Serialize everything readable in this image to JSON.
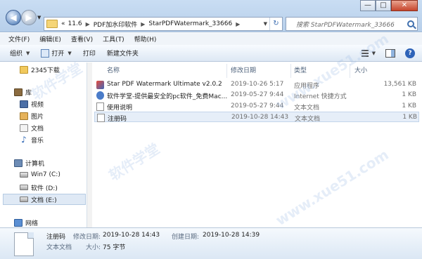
{
  "window": {
    "minimize": "—",
    "maximize": "□",
    "close": "✕"
  },
  "address": {
    "segments": [
      "«",
      "11.6",
      "PDF加水印软件",
      "StarPDFWatermark_33666"
    ],
    "search_placeholder": "搜索 StarPDFWatermark_33666"
  },
  "menubar": [
    "文件(F)",
    "编辑(E)",
    "查看(V)",
    "工具(T)",
    "帮助(H)"
  ],
  "toolbar": {
    "organize": "组织",
    "open": "打开",
    "print": "打印",
    "new_folder": "新建文件夹",
    "help": "?"
  },
  "navpane": {
    "items": [
      {
        "label": "2345下载",
        "icon": "folder-icon"
      },
      {
        "label": "库",
        "icon": "library-icon"
      },
      {
        "label": "视频",
        "icon": "video-icon"
      },
      {
        "label": "图片",
        "icon": "picture-icon"
      },
      {
        "label": "文档",
        "icon": "document-icon"
      },
      {
        "label": "音乐",
        "icon": "music-icon"
      },
      {
        "label": "计算机",
        "icon": "computer-icon"
      },
      {
        "label": "Win7 (C:)",
        "icon": "drive-icon"
      },
      {
        "label": "软件 (D:)",
        "icon": "drive-icon"
      },
      {
        "label": "文档 (E:)",
        "icon": "drive-icon",
        "selected": true
      },
      {
        "label": "网络",
        "icon": "network-icon"
      }
    ]
  },
  "filelist": {
    "columns": [
      "名称",
      "修改日期",
      "类型",
      "大小"
    ],
    "rows": [
      {
        "name": "Star PDF Watermark Ultimate v2.0.2",
        "date": "2019-10-26 5:17",
        "type": "应用程序",
        "size": "13,561 KB",
        "icon": "app-icon"
      },
      {
        "name": "软件学堂-提供最安全的pc软件_免费Mac...",
        "date": "2019-05-27 9:44",
        "type": "Internet 快捷方式",
        "size": "1 KB",
        "icon": "internet-shortcut-icon"
      },
      {
        "name": "使用说明",
        "date": "2019-05-27 9:44",
        "type": "文本文档",
        "size": "1 KB",
        "icon": "text-file-icon"
      },
      {
        "name": "注册码",
        "date": "2019-10-28 14:43",
        "type": "文本文档",
        "size": "1 KB",
        "icon": "text-file-icon",
        "selected": true
      }
    ]
  },
  "details": {
    "name": "注册码",
    "type": "文本文档",
    "modified_label": "修改日期:",
    "modified_value": "2019-10-28 14:43",
    "created_label": "创建日期:",
    "created_value": "2019-10-28 14:39",
    "size_label": "大小:",
    "size_value": "75 字节"
  },
  "watermark": [
    "软件学堂",
    "www.xue51.com",
    "软件学堂",
    "www.xue51.com"
  ]
}
